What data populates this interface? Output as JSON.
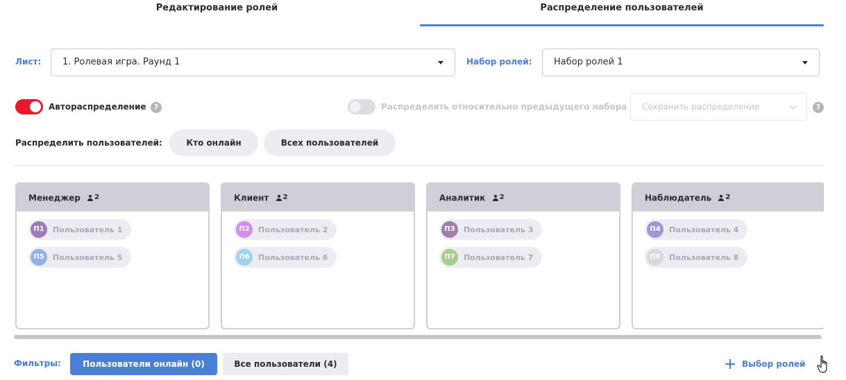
{
  "tabs": [
    {
      "label": "Редактирование ролей",
      "active": false
    },
    {
      "label": "Распределение пользователей",
      "active": true
    }
  ],
  "sheet": {
    "label": "Лист:",
    "value": "1. Ролевая игра. Раунд 1"
  },
  "role_set": {
    "label": "Набор ролей:",
    "value": "Набор ролей 1"
  },
  "auto_distribution": {
    "label": "Автораспределение",
    "on": true,
    "help_icon": "?"
  },
  "relative_distribution": {
    "label": "Распределять относительно предыдущего набора",
    "on": false,
    "disabled": true
  },
  "save_distribution": {
    "label": "Сохранить распределение",
    "disabled": true,
    "help_icon": "?"
  },
  "distribute": {
    "label": "Распределить пользователей:",
    "buttons": [
      "Кто онлайн",
      "Всех пользователей"
    ]
  },
  "roles": [
    {
      "name": "Менеджер",
      "count": "2",
      "users": [
        {
          "initials": "П1",
          "name": "Пользователь 1",
          "color": "#9b7cb3"
        },
        {
          "initials": "П5",
          "name": "Пользователь 5",
          "color": "#8fb1e6"
        }
      ]
    },
    {
      "name": "Клиент",
      "count": "2",
      "users": [
        {
          "initials": "П2",
          "name": "Пользователь 2",
          "color": "#cf8fe8"
        },
        {
          "initials": "П6",
          "name": "Пользователь 6",
          "color": "#9fd0f0"
        }
      ]
    },
    {
      "name": "Аналитик",
      "count": "2",
      "users": [
        {
          "initials": "П3",
          "name": "Пользователь 3",
          "color": "#a07fa8"
        },
        {
          "initials": "П7",
          "name": "Пользователь 7",
          "color": "#a9cc8d"
        }
      ]
    },
    {
      "name": "Наблюдатель",
      "count": "2",
      "users": [
        {
          "initials": "П4",
          "name": "Пользователь 4",
          "color": "#9d96d8"
        },
        {
          "initials": "П8",
          "name": "Пользователь 8",
          "color": "#d8d8de"
        }
      ]
    }
  ],
  "filters": {
    "label": "Фильтры:",
    "online": "Пользователи онлайн (0)",
    "all": "Все пользователи (4)"
  },
  "select_roles": "Выбор ролей",
  "colors": {
    "accent": "#4a7fd6",
    "toggle_on": "#e8192c"
  }
}
